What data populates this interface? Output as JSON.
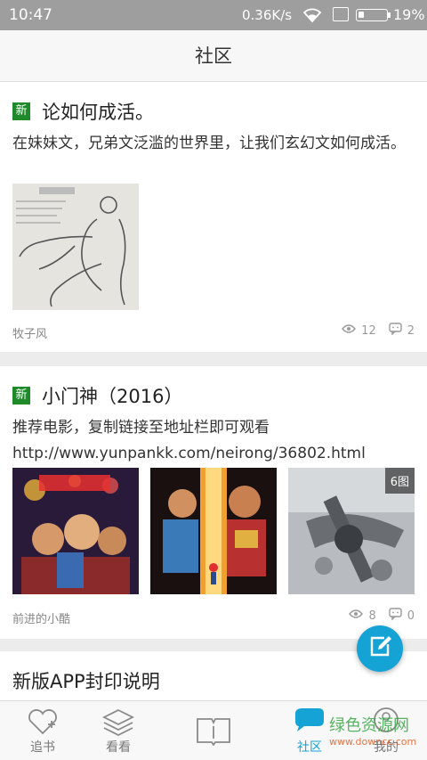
{
  "status_bar": {
    "time": "10:47",
    "speed": "0.36K/s",
    "battery": "19%",
    "battery_level": 0.19
  },
  "header": {
    "title": "社区"
  },
  "posts": [
    {
      "badge": "新",
      "title": "论如何成活。",
      "body": "在妹妹文，兄弟文泛滥的世界里，让我们玄幻文如何成活。",
      "author": "牧子风",
      "views": "12",
      "comments": "2"
    },
    {
      "badge": "新",
      "title": "小门神（2016）",
      "body_line1": "推荐电影，复制链接至地址栏即可观看",
      "body_line2": "http://www.yunpankk.com/neirong/36802.html",
      "image_count": "6图",
      "author": "前进的小酷",
      "views": "8",
      "comments": "0"
    },
    {
      "title": "新版APP封印说明"
    }
  ],
  "tabs": [
    {
      "label": "追书",
      "icon": "heart-plus-icon"
    },
    {
      "label": "看看",
      "icon": "layers-icon"
    },
    {
      "label": "",
      "icon": "book-icon"
    },
    {
      "label": "社区",
      "icon": "chat-bubble-icon",
      "active": true
    },
    {
      "label": "我的",
      "icon": "person-icon"
    }
  ],
  "watermark": {
    "main": "绿色资源网",
    "sub": "www.downcc.com"
  },
  "colors": {
    "accent": "#15a3d6",
    "badge": "#1e8a2a",
    "watermark_green": "#3aa847"
  }
}
